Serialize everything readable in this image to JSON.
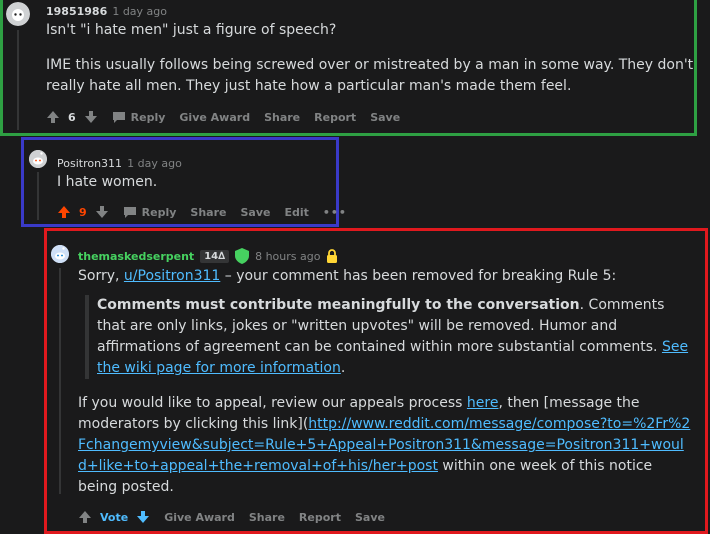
{
  "comment1": {
    "author": "19851986",
    "time": "1 day ago",
    "paragraphs": [
      "Isn't \"i hate men\" just a figure of speech?",
      "IME this usually follows being screwed over or mistreated by a man in some way. They don't really hate all men. They just hate how a particular man's made them feel."
    ],
    "score": "6",
    "actions": [
      "Reply",
      "Give Award",
      "Share",
      "Report",
      "Save"
    ],
    "frame_color": "#2ea043"
  },
  "comment2": {
    "author": "Positron311",
    "time": "1 day ago",
    "body": "I hate women.",
    "score": "9",
    "actions": [
      "Reply",
      "Share",
      "Save",
      "Edit"
    ],
    "more": "•••",
    "frame_color": "#3a3ac8",
    "upvote_color": "#ff4500"
  },
  "comment3": {
    "author": "themaskedserpent",
    "flair": "14∆",
    "time": "8 hours ago",
    "intro_pre": "Sorry, ",
    "intro_user_link": "u/Positron311",
    "intro_post": " – your comment has been removed for breaking Rule 5:",
    "rule_bold": "Comments must contribute meaningfully to the conversation",
    "rule_rest": ". Comments that are only links, jokes or \"written upvotes\" will be removed. Humor and affirmations of agreement can be contained within more substantial comments. ",
    "wiki_link": "See the wiki page for more information",
    "wiki_end": ".",
    "appeal_pre": "If you would like to appeal, review our appeals process ",
    "appeal_here": "here",
    "appeal_mid": ", then [message the moderators by clicking this link](",
    "appeal_url": "http://www.reddit.com/message/compose?to=%2Fr%2Fchangemyview&subject=Rule+5+Appeal+Positron311&message=Positron311+would+like+to+appeal+the+removal+of+his/her+post",
    "appeal_post": " within one week of this notice being posted.",
    "vote_label": "Vote",
    "actions": [
      "Give Award",
      "Share",
      "Report",
      "Save"
    ],
    "frame_color": "#e0191e",
    "author_color": "#46d160",
    "shield_color": "#46d160",
    "lock_color": "#ffd635"
  }
}
